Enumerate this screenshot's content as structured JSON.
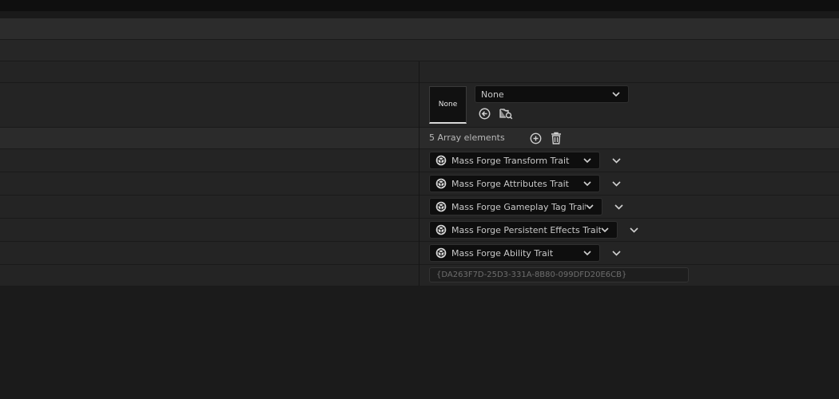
{
  "asset_picker": {
    "thumbnail_label": "None",
    "selected_value": "None"
  },
  "traits": {
    "count_label": "5 Array elements",
    "items": [
      {
        "label": "Mass Forge Transform Trait"
      },
      {
        "label": "Mass Forge Attributes Trait"
      },
      {
        "label": "Mass Forge Gameplay Tag Trait"
      },
      {
        "label": "Mass Forge Persistent Effects Trait"
      },
      {
        "label": "Mass Forge Ability Trait"
      }
    ]
  },
  "guid": {
    "value": "{DA263F7D-25D3-331A-8B80-099DFD20E6CB}"
  },
  "icons": {
    "browse": "use-selected-arrow-icon",
    "find": "browse-folder-icon",
    "add": "add-circle-icon",
    "delete": "trash-icon",
    "trait": "mass-trait-icon",
    "expand": "chevron-down-icon"
  },
  "colors": {
    "background": "#1b1b1b",
    "row": "#242424",
    "field": "#0e0e0e",
    "text": "#c8c8c8"
  }
}
